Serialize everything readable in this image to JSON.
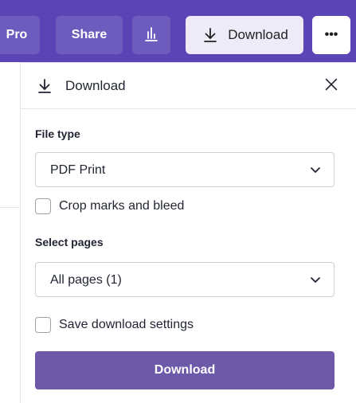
{
  "colors": {
    "toolbar_bg": "#5b45b6",
    "primary_button": "#6e58aa",
    "download_chip": "#efeaf8"
  },
  "topbar": {
    "pro_label": "Pro",
    "share_label": "Share",
    "stats_icon": "bar-chart-icon",
    "download_label": "Download",
    "download_icon": "download-arrow-icon",
    "more_label": "•••"
  },
  "panel": {
    "title": "Download",
    "title_icon": "download-arrow-icon",
    "close_icon": "close-icon",
    "file_type": {
      "label": "File type",
      "selected": "PDF Print"
    },
    "crop_marks": {
      "label": "Crop marks and bleed",
      "checked": false
    },
    "pages": {
      "label": "Select pages",
      "selected": "All pages (1)"
    },
    "save_settings": {
      "label": "Save download settings",
      "checked": false
    },
    "action_label": "Download"
  }
}
